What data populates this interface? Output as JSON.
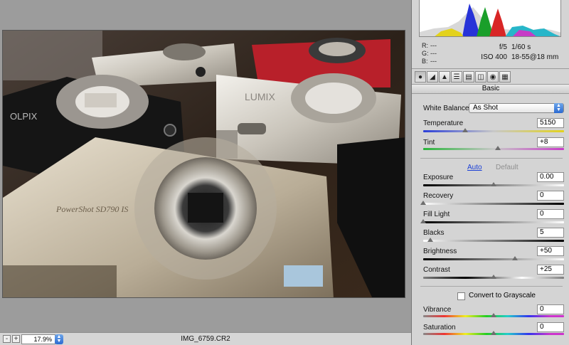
{
  "footer": {
    "zoom_out_label": "-",
    "zoom_in_label": "+",
    "zoom_value": "17.9%",
    "filename": "IMG_6759.CR2"
  },
  "readout": {
    "r_label": "R:",
    "r_value": "---",
    "g_label": "G:",
    "g_value": "---",
    "b_label": "B:",
    "b_value": "---",
    "aperture": "f/5",
    "shutter": "1/60 s",
    "iso": "ISO 400",
    "lens": "18-55@18 mm"
  },
  "panel": {
    "section_title": "Basic",
    "white_balance_label": "White Balance:",
    "white_balance_value": "As Shot",
    "auto_label": "Auto",
    "default_label": "Default",
    "grayscale_label": "Convert to Grayscale",
    "grayscale_checked": false,
    "tabs": [
      "basic",
      "tone-curve",
      "detail",
      "hsl",
      "split-toning",
      "lens",
      "camera-calibration",
      "presets"
    ]
  },
  "sliders": {
    "temperature": {
      "label": "Temperature",
      "value": "5150",
      "position": 0.3
    },
    "tint": {
      "label": "Tint",
      "value": "+8",
      "position": 0.53
    },
    "exposure": {
      "label": "Exposure",
      "value": "0.00",
      "position": 0.5
    },
    "recovery": {
      "label": "Recovery",
      "value": "0",
      "position": 0.0
    },
    "fill_light": {
      "label": "Fill Light",
      "value": "0",
      "position": 0.0
    },
    "blacks": {
      "label": "Blacks",
      "value": "5",
      "position": 0.05
    },
    "brightness": {
      "label": "Brightness",
      "value": "+50",
      "position": 0.65
    },
    "contrast": {
      "label": "Contrast",
      "value": "+25",
      "position": 0.5
    },
    "vibrance": {
      "label": "Vibrance",
      "value": "0",
      "position": 0.5
    },
    "saturation": {
      "label": "Saturation",
      "value": "0",
      "position": 0.5
    }
  },
  "colors": {
    "link_blue": "#1a3fd6",
    "popup_blue": "#2b6ad1"
  }
}
